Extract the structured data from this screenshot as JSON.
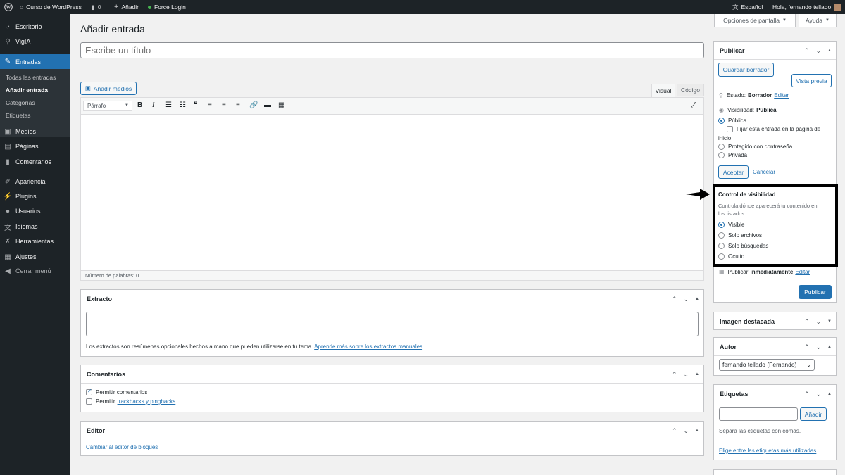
{
  "adminbar": {
    "site_name": "Curso de WordPress",
    "comments_count": "0",
    "new_label": "Añadir",
    "force_login": "Force Login",
    "language": "Español",
    "greeting": "Hola, fernando tellado"
  },
  "sidebar": {
    "items": [
      {
        "label": "Escritorio",
        "icon": "dashboard-icon"
      },
      {
        "label": "VigIA",
        "icon": "search-icon"
      },
      {
        "label": "Entradas",
        "icon": "pin-icon"
      },
      {
        "label": "Medios",
        "icon": "media-icon"
      },
      {
        "label": "Páginas",
        "icon": "pages-icon"
      },
      {
        "label": "Comentarios",
        "icon": "comment-icon"
      },
      {
        "label": "Apariencia",
        "icon": "brush-icon"
      },
      {
        "label": "Plugins",
        "icon": "plugin-icon"
      },
      {
        "label": "Usuarios",
        "icon": "user-icon"
      },
      {
        "label": "Idiomas",
        "icon": "translate-icon"
      },
      {
        "label": "Herramientas",
        "icon": "wrench-icon"
      },
      {
        "label": "Ajustes",
        "icon": "settings-icon"
      },
      {
        "label": "Cerrar menú",
        "icon": "collapse-icon"
      }
    ],
    "submenu": [
      "Todas las entradas",
      "Añadir entrada",
      "Categorías",
      "Etiquetas"
    ]
  },
  "screen_options": "Opciones de pantalla",
  "help": "Ayuda",
  "page_title": "Añadir entrada",
  "title_placeholder": "Escribe un título",
  "editor": {
    "add_media": "Añadir medios",
    "tab_visual": "Visual",
    "tab_code": "Código",
    "format": "Párrafo",
    "word_count": "Número de palabras: 0"
  },
  "excerpt": {
    "title": "Extracto",
    "help": "Los extractos son resúmenes opcionales hechos a mano que pueden utilizarse en tu tema.",
    "link": "Aprende más sobre los extractos manuales"
  },
  "comments_box": {
    "title": "Comentarios",
    "allow_comments": "Permitir comentarios",
    "allow_prefix": "Permitir",
    "trackbacks": "trackbacks y pingbacks"
  },
  "editor_box": {
    "title": "Editor",
    "link": "Cambiar al editor de bloques"
  },
  "publish": {
    "title": "Publicar",
    "save_draft": "Guardar borrador",
    "preview": "Vista previa",
    "status_label": "Estado:",
    "status_value": "Borrador",
    "edit": "Editar",
    "visibility_label": "Visibilidad:",
    "visibility_value": "Pública",
    "opt_public": "Pública",
    "sticky": "Fijar esta entrada en la página de",
    "sticky2": "inicio",
    "opt_password": "Protegido con contraseña",
    "opt_private": "Privada",
    "accept": "Aceptar",
    "cancel": "Cancelar",
    "publish_label": "Publicar",
    "publish_value": "inmediatamente",
    "publish_button": "Publicar"
  },
  "visibility_control": {
    "title": "Control de visibilidad",
    "desc1": "Controla dónde aparecerá tu contenido en",
    "desc2": "los listados.",
    "options": [
      "Visible",
      "Solo archivos",
      "Solo búsquedas",
      "Oculto"
    ],
    "selected": "Visible"
  },
  "featured_image": {
    "title": "Imagen destacada"
  },
  "author": {
    "title": "Autor",
    "value": "fernando tellado (Fernando)"
  },
  "tags": {
    "title": "Etiquetas",
    "add": "Añadir",
    "help": "Separa las etiquetas con comas.",
    "link": "Elige entre las etiquetas más utilizadas"
  },
  "colors": {
    "accent": "#2271b1",
    "adminbar": "#1d2327",
    "highlight_border": "#000000"
  }
}
